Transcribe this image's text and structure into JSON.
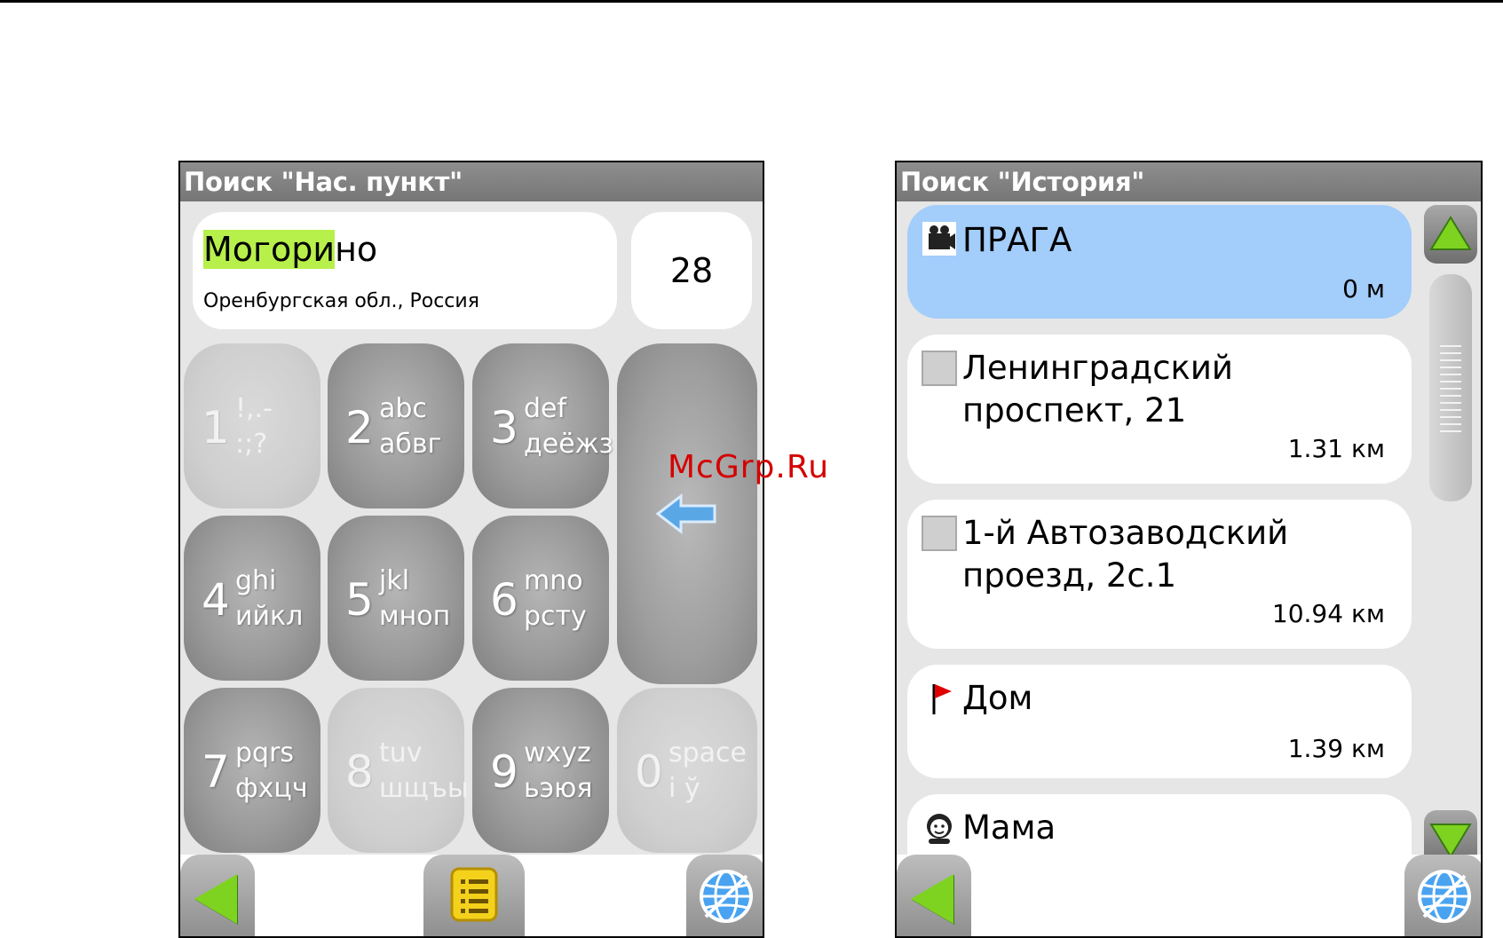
{
  "left_screen": {
    "title": "Поиск \"Нас. пункт\"",
    "result": {
      "name_matched": "Могори",
      "name_rest": "но",
      "region": "Оренбургская обл., Россия"
    },
    "count": "28",
    "keys": [
      {
        "digit": "1",
        "lat": "!,.-",
        "cyr": ":;?",
        "enabled": false
      },
      {
        "digit": "2",
        "lat": "abc",
        "cyr": "абвг",
        "enabled": true
      },
      {
        "digit": "3",
        "lat": "def",
        "cyr": "деёжз",
        "enabled": true
      },
      {
        "digit": "4",
        "lat": "ghi",
        "cyr": "ийкл",
        "enabled": true
      },
      {
        "digit": "5",
        "lat": "jkl",
        "cyr": "мноп",
        "enabled": true
      },
      {
        "digit": "6",
        "lat": "mno",
        "cyr": "рсту",
        "enabled": true
      },
      {
        "digit": "7",
        "lat": "pqrs",
        "cyr": "фхцч",
        "enabled": true
      },
      {
        "digit": "8",
        "lat": "tuv",
        "cyr": "шщъы",
        "enabled": false
      },
      {
        "digit": "9",
        "lat": "wxyz",
        "cyr": "ьэюя",
        "enabled": true
      },
      {
        "digit": "0",
        "lat": "space",
        "cyr": "і ў",
        "enabled": false
      }
    ]
  },
  "right_screen": {
    "title": "Поиск \"История\"",
    "items": [
      {
        "name": "ПРАГА",
        "distance": "0 м",
        "icon": "camera-icon",
        "selected": true
      },
      {
        "name": "Ленинградский проспект, 21",
        "distance": "1.31 км",
        "icon": "box-icon",
        "selected": false
      },
      {
        "name": "1-й Автозаводский проезд, 2с.1",
        "distance": "10.94 км",
        "icon": "box-icon",
        "selected": false
      },
      {
        "name": "Дом",
        "distance": "1.39 км",
        "icon": "flag-icon",
        "selected": false
      },
      {
        "name": "Мама",
        "distance": "",
        "icon": "person-icon",
        "selected": false
      }
    ]
  },
  "watermark": "McGrp.Ru",
  "colors": {
    "titlebar": "#7e7e7e",
    "highlight": "#b7f04a",
    "selected_item": "#a3cdfa",
    "nav_arrow": "#7ed321",
    "backspace_arrow": "#5aa7e6"
  }
}
